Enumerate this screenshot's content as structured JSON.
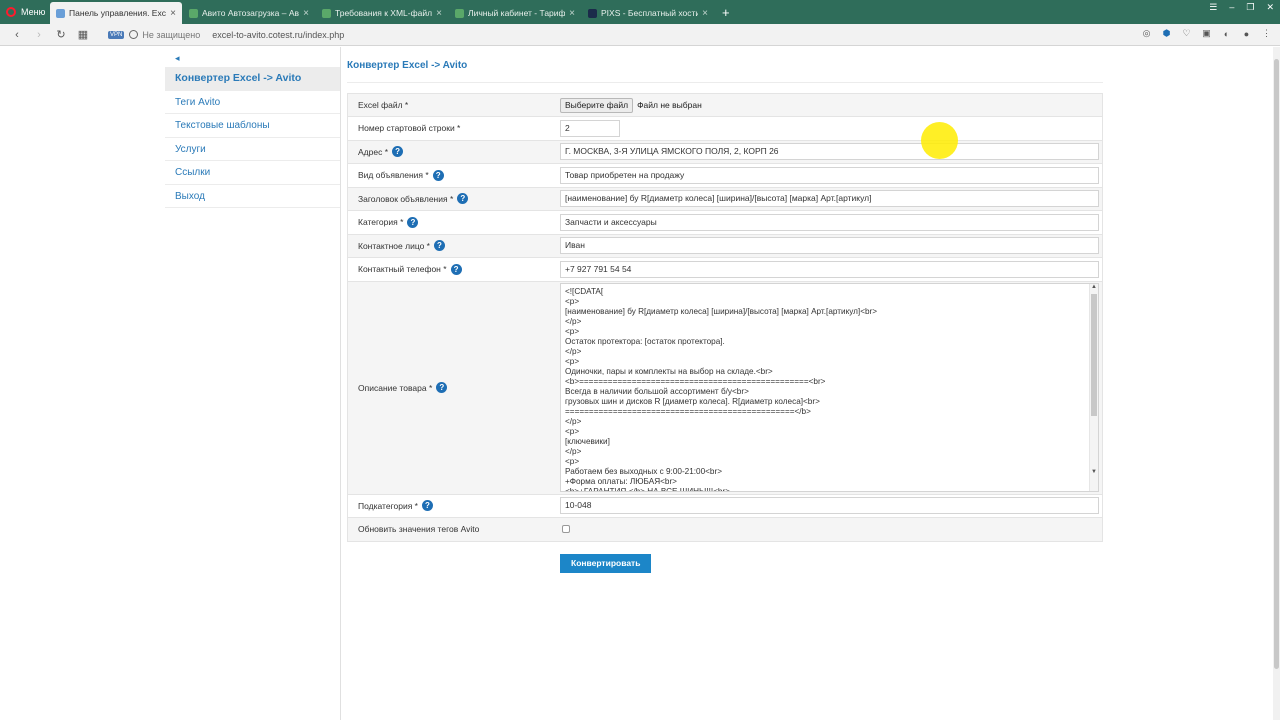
{
  "browser": {
    "menu_label": "Меню",
    "tabs": [
      {
        "title": "Панель управления. Excel",
        "active": true,
        "color": "#6a9fd8"
      },
      {
        "title": "Авито Автозагрузка – Ави",
        "active": false,
        "color": "#5aa869"
      },
      {
        "title": "Требования к XML-файлу",
        "active": false,
        "color": "#5aa869"
      },
      {
        "title": "Личный кабинет - Тариф",
        "active": false,
        "color": "#5aa869"
      },
      {
        "title": "PIXS - Бесплатный хостин",
        "active": false,
        "color": "#1b2a4a"
      }
    ],
    "vpn_label": "VPN",
    "insecure_label": "Не защищено",
    "url": "excel-to-avito.cotest.ru/index.php"
  },
  "sidebar": {
    "collapse_icon": "◂",
    "items": [
      {
        "label": "Конвертер Excel -> Avito",
        "active": true
      },
      {
        "label": "Теги Avito",
        "active": false
      },
      {
        "label": "Текстовые шаблоны",
        "active": false
      },
      {
        "label": "Услуги",
        "active": false
      },
      {
        "label": "Ссылки",
        "active": false
      },
      {
        "label": "Выход",
        "active": false
      }
    ]
  },
  "main": {
    "title": "Конвертер Excel -> Avito",
    "form": {
      "excel_file": {
        "label": "Excel файл *",
        "button": "Выберите файл",
        "status": "Файл не выбран"
      },
      "start_row": {
        "label": "Номер стартовой строки *",
        "value": "2"
      },
      "address": {
        "label": "Адрес *",
        "value": "Г. МОСКВА, 3-Я УЛИЦА ЯМСКОГО ПОЛЯ, 2, КОРП 26"
      },
      "ad_type": {
        "label": "Вид объявления *",
        "value": "Товар приобретен на продажу"
      },
      "ad_title": {
        "label": "Заголовок объявления *",
        "value": "[наименование] бу R[диаметр колеса] [ширина]/[высота] [марка] Арт.[артикул]"
      },
      "category": {
        "label": "Категория *",
        "value": "Запчасти и аксессуары"
      },
      "contact_person": {
        "label": "Контактное лицо *",
        "value": "Иван"
      },
      "contact_phone": {
        "label": "Контактный телефон *",
        "value": "+7 927 791 54 54"
      },
      "description": {
        "label": "Описание товара *",
        "lines": [
          "<![CDATA[",
          "<p>",
          "[наименование] бу R[диаметр колеса] [ширина]/[высота] [марка] Арт.[артикул]<br>",
          "</p>",
          "<p>",
          "Остаток протектора: [остаток протектора].",
          "</p>",
          "<p>",
          "Одиночки, пары и комплекты на выбор на складе.<br>",
          "<b>================================================<br>",
          "Всегда в наличии большой ассортимент б/у<br>",
          "грузовых шин и дисков R [диаметр колеса]. R[диаметр колеса]<br>",
          "================================================</b>",
          "</p>",
          "<p>",
          "[ключевики]",
          "</p>",
          "<p>",
          "Работаем без выходных с 9:00-21:00<br>",
          "+Форма оплаты: ЛЮБАЯ<br>",
          "<b>+ГАРАНТИЯ </b> НА ВСЕ ШИНЫ!!!<br>"
        ]
      },
      "subcategory": {
        "label": "Подкатегория *",
        "value": "10-048"
      },
      "update_tags": {
        "label": "Обновить значения тегов Avito",
        "checked": false
      }
    },
    "submit_label": "Конвертировать"
  },
  "colors": {
    "accent": "#2a7ab8",
    "button": "#1c86c8",
    "tabbar": "#2f6d5a",
    "help": "#1e6eb4"
  }
}
